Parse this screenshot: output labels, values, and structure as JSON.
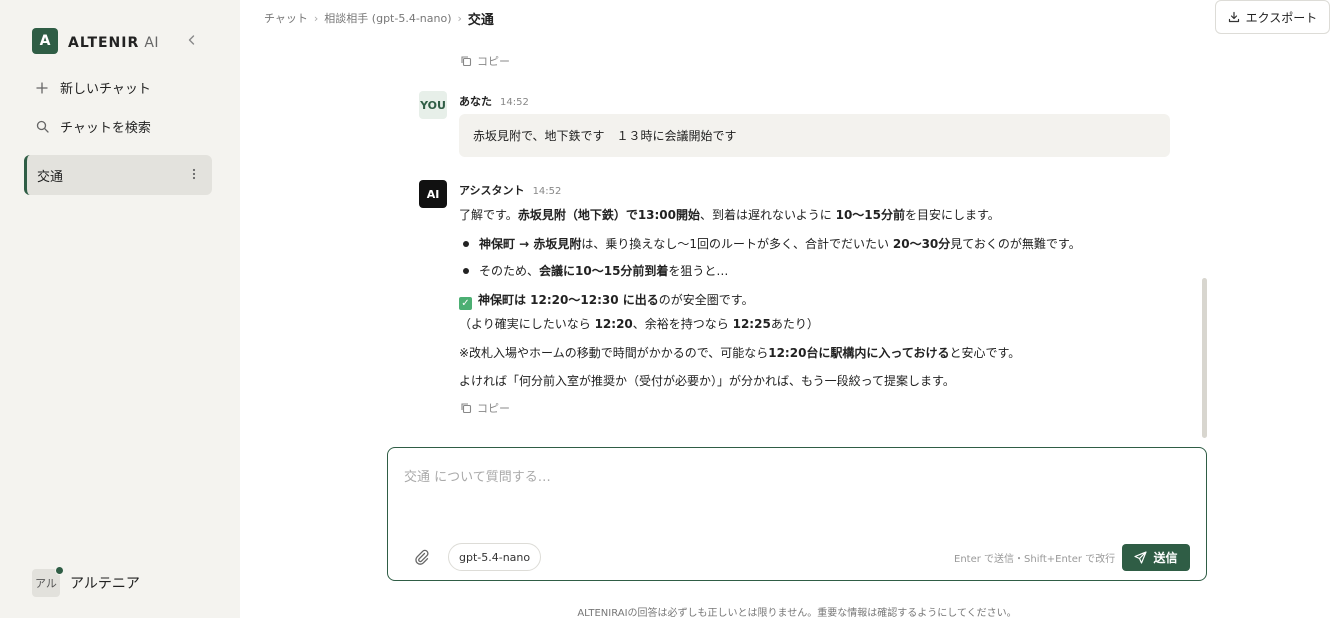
{
  "colors": {
    "brand": "#2f5d45",
    "sidebar_bg": "#f4f3ef",
    "active_item_bg": "#e3e2dd",
    "bubble_bg": "#f3f2ee"
  },
  "sidebar": {
    "logo_letter": "A",
    "brand_name": "ALTENIR",
    "brand_suffix": "AI",
    "collapse_icon": "chevron-left-icon",
    "new_chat": "新しいチャット",
    "search_chat": "チャットを検索",
    "chats": [
      {
        "label": "交通",
        "active": true
      }
    ],
    "user": {
      "initials": "アル",
      "name": "アルテニア",
      "online": true
    }
  },
  "header": {
    "breadcrumb": [
      "チャット",
      "相談相手 (gpt-5.4-nano)",
      "交通"
    ],
    "export_label": "エクスポート"
  },
  "messages": {
    "copy_label": "コピー",
    "user_msg": {
      "avatar": "YOU",
      "author": "あなた",
      "time": "14:52",
      "text": "赤坂見附で、地下鉄です　１３時に会議開始です"
    },
    "ai_msg": {
      "avatar": "AI",
      "author": "アシスタント",
      "time": "14:52",
      "l1a": "了解です。",
      "l1b": "赤坂見附（地下鉄）で13:00開始",
      "l1c": "、到着は遅れないように ",
      "l1d": "10〜15分前",
      "l1e": "を目安にします。",
      "b1a": "神保町 → 赤坂見附",
      "b1b": "は、乗り換えなし〜1回のルートが多く、合計でだいたい ",
      "b1c": "20〜30分",
      "b1d": "見ておくのが無難です。",
      "b2a": "そのため、",
      "b2b": "会議に10〜15分前到着",
      "b2c": "を狙うと…",
      "c1a": "神保町は 12:20〜12:30 に出る",
      "c1b": "のが安全圏です。",
      "c2a": "（より確実にしたいなら ",
      "c2b": "12:20",
      "c2c": "、余裕を持つなら ",
      "c2d": "12:25",
      "c2e": "あたり）",
      "n1a": "※改札入場やホームの移動で時間がかかるので、可能なら",
      "n1b": "12:20台に駅構内に入っておける",
      "n1c": "と安心です。",
      "n2": "よければ「何分前入室が推奨か（受付が必要か）」が分かれば、もう一段絞って提案します。"
    }
  },
  "composer": {
    "placeholder": "交通 について質問する…",
    "model": "gpt-5.4-nano",
    "hint": "Enter で送信・Shift+Enter で改行",
    "send_label": "送信"
  },
  "footer": {
    "disclaimer": "ALTENIRAIの回答は必ずしも正しいとは限りません。重要な情報は確認するようにしてください。"
  }
}
